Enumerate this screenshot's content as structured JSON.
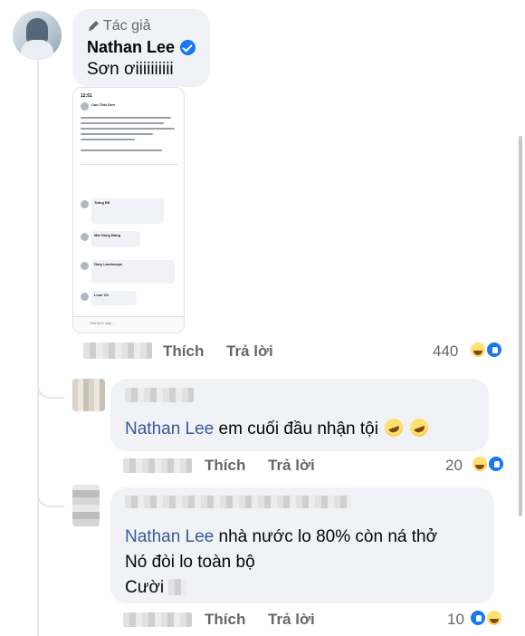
{
  "author_post": {
    "badge": "Tác giả",
    "name": "Nathan Lee",
    "text": "Sơn ơiiiiiiiiii",
    "actions": {
      "like": "Thích",
      "reply": "Trả lời"
    },
    "reaction_count": "440",
    "reactions": [
      "haha",
      "like"
    ],
    "screenshot": {
      "time": "12:51",
      "poster": "Cao Thái Sơn",
      "comment_names": [
        "Trang Đỗ",
        "Mai Hồng Đăng",
        "Gary Landscape",
        "Leon Vũ"
      ],
      "comment_box": "Viết bình luận..."
    }
  },
  "replies": [
    {
      "mention": "Nathan Lee",
      "lines": [
        "em cuối đầu nhận tội"
      ],
      "actions": {
        "like": "Thích",
        "reply": "Trả lời"
      },
      "reaction_count": "20",
      "reactions": [
        "haha",
        "like"
      ]
    },
    {
      "mention": "Nathan Lee",
      "lines": [
        "nhà nước lo 80% còn ná thở",
        "Nó đòi lo toàn bộ",
        "Cười"
      ],
      "actions": {
        "like": "Thích",
        "reply": "Trả lời"
      },
      "reaction_count": "10",
      "reactions": [
        "like",
        "haha"
      ]
    }
  ],
  "colors": {
    "mention": "#385898",
    "bubble": "#f0f2f5",
    "muted": "#65676b",
    "verified": "#1877f2"
  },
  "icons": [
    "pencil-icon",
    "verified-badge-icon",
    "haha-reaction-icon",
    "like-reaction-icon",
    "rofl-emoji-icon"
  ]
}
